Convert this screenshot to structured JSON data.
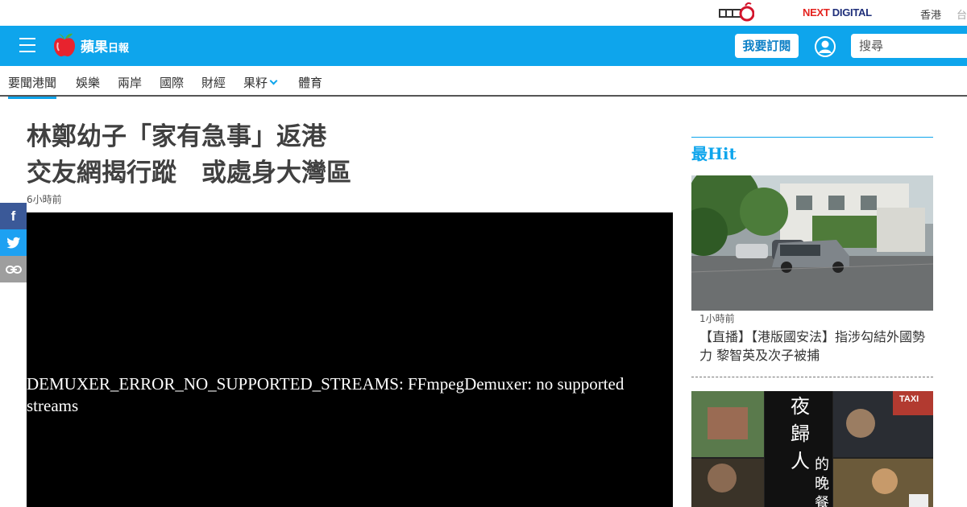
{
  "topbar": {
    "brand_partner": "NEXT DIGITAL",
    "brand_partner_prefix": "NEXT",
    "brand_partner_suffix": " DIGITAL",
    "regions": [
      "香港",
      "台"
    ]
  },
  "header": {
    "logo_main": "蘋果",
    "logo_sub": "日報",
    "subscribe_label": "我要訂閱",
    "search_placeholder": "搜尋",
    "accent_color": "#0ea5ec"
  },
  "nav": {
    "items": [
      "要聞港聞",
      "娛樂",
      "兩岸",
      "國際",
      "財經",
      "果籽",
      "體育"
    ],
    "active": "要聞港聞"
  },
  "article": {
    "headline_line1": "林鄭幼子「家有急事」返港",
    "headline_line2": "交友網揭行蹤　或處身大灣區",
    "timestamp": "6小時前",
    "video_error": "DEMUXER_ERROR_NO_SUPPORTED_STREAMS: FFmpegDemuxer: no supported streams"
  },
  "share": {
    "icons": [
      "facebook-icon",
      "twitter-icon",
      "link-icon"
    ]
  },
  "sidebar": {
    "title": "最Hit",
    "story1": {
      "time": "1小時前",
      "title": "【直播】【港版國安法】指涉勾結外國勢力 黎智英及次子被捕"
    },
    "story2_image_text": [
      "夜",
      "歸",
      "人",
      "的",
      "晚",
      "餐"
    ],
    "story2_taxi": "TAXI"
  }
}
